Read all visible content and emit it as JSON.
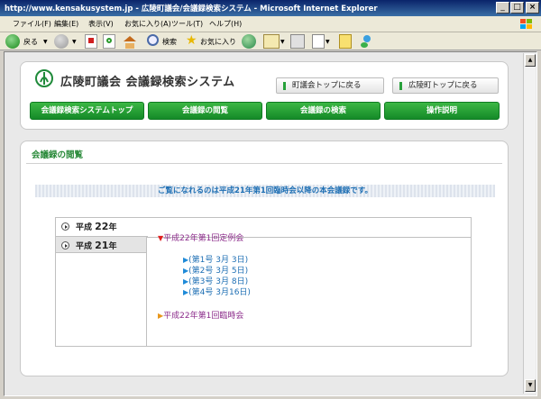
{
  "window": {
    "title": "http://www.kensakusystem.jp - 広陵町議会/会議録検索システム - Microsoft Internet Explorer",
    "controls": [
      "_",
      "□",
      "×"
    ]
  },
  "menu": [
    "ファイル(F)",
    "編集(E)",
    "表示(V)",
    "お気に入り(A)",
    "ツール(T)",
    "ヘルプ(H)"
  ],
  "toolbar": {
    "back": "戻る",
    "search": "検索",
    "favorites": "お気に入り"
  },
  "header": {
    "site_title": "広陵町議会 会議録検索システム",
    "link_council_top": "町議会トップに戻る",
    "link_town_top": "広陵町トップに戻る",
    "nav": [
      "会議録検索システムトップ",
      "会議録の閲覧",
      "会議録の検索",
      "操作説明"
    ]
  },
  "section": {
    "title": "会議録の閲覧",
    "notice": "ご覧になれるのは平成21年第1回臨時会以降の本会議録です。"
  },
  "years": [
    {
      "prefix": "平成",
      "num": "22",
      "suffix": "年"
    },
    {
      "prefix": "平成",
      "num": "21",
      "suffix": "年"
    }
  ],
  "meetings": [
    {
      "marker": "▼",
      "title": "平成22年第1回定例会",
      "sessions": [
        "(第1号 3月 3日)",
        "(第2号 3月 5日)",
        "(第3号 3月 8日)",
        "(第4号 3月16日)"
      ]
    },
    {
      "marker": "▶",
      "title": "平成22年第1回臨時会",
      "sessions": []
    }
  ],
  "session_marker": "▶",
  "colors": {
    "title_bar": "#0a246a",
    "nav_green": "#148a28",
    "accent_blue": "#1e6fb4",
    "meeting_purple": "#8b2a8a",
    "open_marker": "#e02020",
    "closed_marker": "#e8961a"
  }
}
